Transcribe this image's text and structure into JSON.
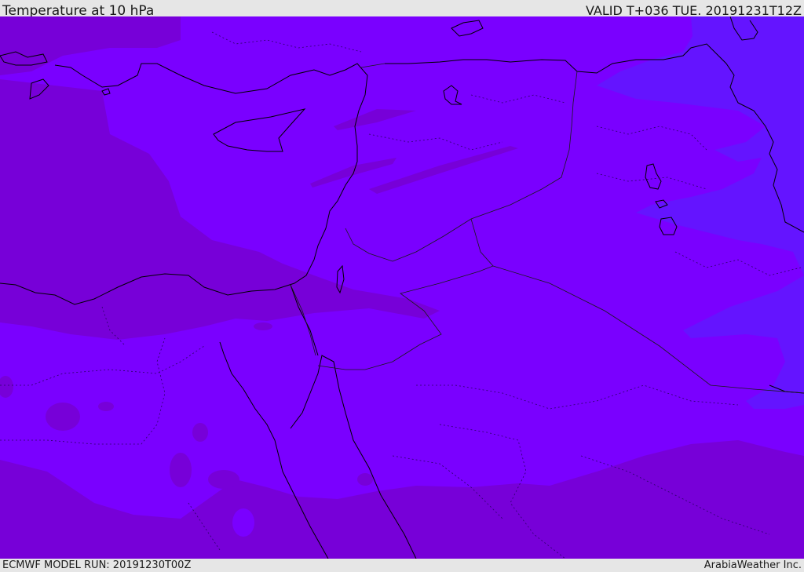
{
  "header": {
    "title": "Temperature at 10 hPa",
    "valid_time": "VALID T+036 TUE. 20191231T12Z"
  },
  "footer": {
    "model_run": "ECMWF MODEL RUN: 20191230T00Z",
    "credit": "ArabiaWeather Inc."
  },
  "map": {
    "region": "Eastern Mediterranean and Middle East",
    "colors": {
      "warm_band": "#7700d8",
      "base": "#7a00ff",
      "cool_band": "#6414ff",
      "coastline": "#000000"
    },
    "overlays": [
      "coastlines",
      "country-borders",
      "admin-borders"
    ]
  }
}
